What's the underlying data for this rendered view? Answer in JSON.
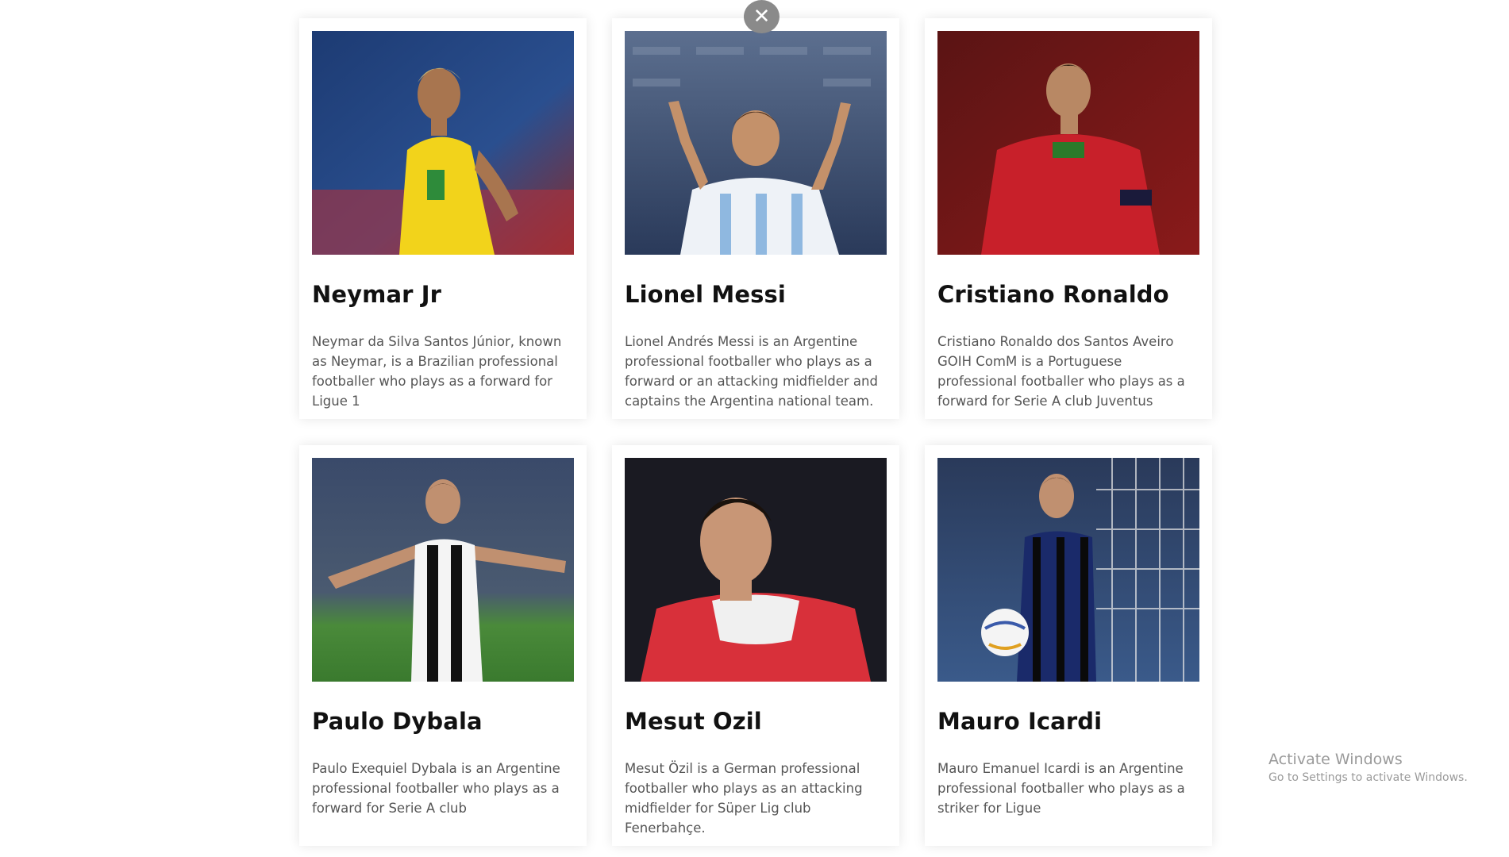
{
  "close_icon": "close-icon",
  "cards": [
    {
      "name": "Neymar Jr",
      "description": "Neymar da Silva Santos Júnior, known as Neymar, is a Brazilian professional footballer who plays as a forward for Ligue 1",
      "photo": "neymar-photo"
    },
    {
      "name": "Lionel Messi",
      "description": "Lionel Andrés Messi is an Argentine professional footballer who plays as a forward or an attacking midfielder and captains the Argentina national team.",
      "photo": "messi-photo"
    },
    {
      "name": "Cristiano Ronaldo",
      "description": "Cristiano Ronaldo dos Santos Aveiro GOIH ComM is a Portuguese professional footballer who plays as a forward for Serie A club Juventus",
      "photo": "ronaldo-photo"
    },
    {
      "name": "Paulo Dybala",
      "description": "Paulo Exequiel Dybala is an Argentine professional footballer who plays as a forward for Serie A club",
      "photo": "dybala-photo"
    },
    {
      "name": "Mesut Ozil",
      "description": "Mesut Özil is a German professional footballer who plays as an attacking midfielder for Süper Lig club Fenerbahçe.",
      "photo": "ozil-photo"
    },
    {
      "name": "Mauro Icardi",
      "description": "Mauro Emanuel Icardi is an Argentine professional footballer who plays as a striker for Ligue",
      "photo": "icardi-photo"
    }
  ],
  "watermark": {
    "line1": "Activate Windows",
    "line2": "Go to Settings to activate Windows."
  }
}
